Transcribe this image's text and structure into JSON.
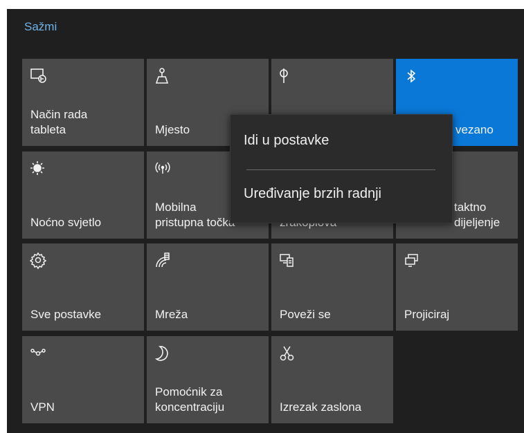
{
  "header": {
    "collapse_label": "Sažmi"
  },
  "tiles": [
    {
      "label": "Način rada\ntableta",
      "icon": "tablet-mode-icon"
    },
    {
      "label": "Mjesto",
      "icon": "location-icon"
    },
    {
      "label": "",
      "icon": "focus-pin-icon"
    },
    {
      "label": "vezano",
      "icon": "bluetooth-icon",
      "active": true
    },
    {
      "label": "Noćno svjetlo",
      "icon": "night-light-icon"
    },
    {
      "label": "Mobilna\npristupna točka",
      "icon": "hotspot-icon"
    },
    {
      "label": "zrakoplova",
      "icon": "airplane-icon"
    },
    {
      "label": "taktno\ndijeljenje",
      "icon": "nearby-share-icon"
    },
    {
      "label": "Sve postavke",
      "icon": "gear-icon"
    },
    {
      "label": "Mreža",
      "icon": "network-icon"
    },
    {
      "label": "Poveži se",
      "icon": "connect-icon"
    },
    {
      "label": "Projiciraj",
      "icon": "project-icon"
    },
    {
      "label": "VPN",
      "icon": "vpn-icon"
    },
    {
      "label": "Pomoćnik za\nkoncentraciju",
      "icon": "moon-icon"
    },
    {
      "label": "Izrezak zaslona",
      "icon": "snip-icon"
    }
  ],
  "context_menu": {
    "items": [
      "Idi u postavke",
      "Uređivanje brzih radnji"
    ]
  },
  "colors": {
    "accent": "#0a78d7",
    "tile": "#4a4a4a",
    "background": "#1f1f1f",
    "link": "#6fb2e8"
  }
}
